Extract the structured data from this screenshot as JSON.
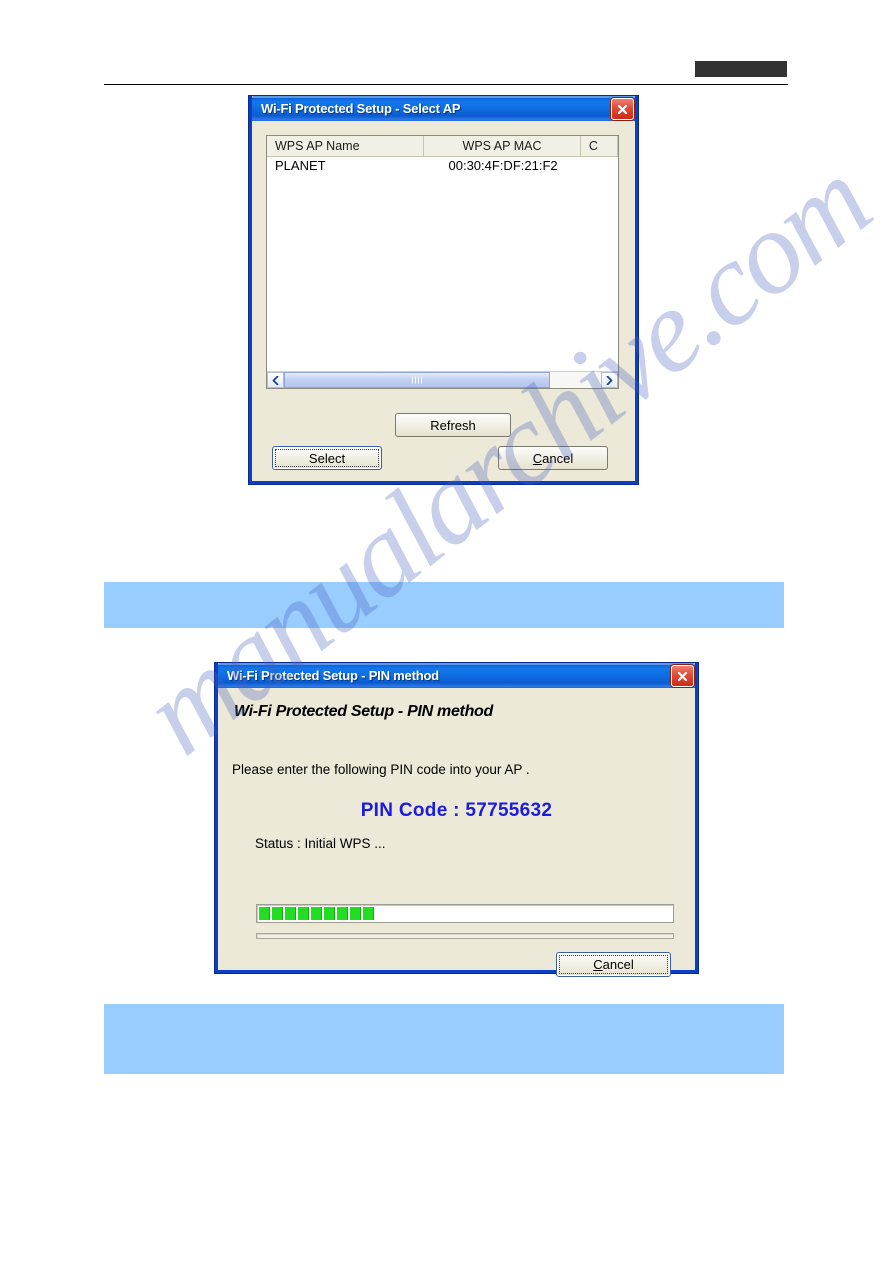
{
  "page": {
    "header_redacted_block": "",
    "watermark_text": "manualarchive.com"
  },
  "bands": {
    "band_1_text": "",
    "band_2_text": ""
  },
  "dialog_select_ap": {
    "title": "Wi-Fi Protected Setup - Select AP",
    "close_icon": "close-icon",
    "list": {
      "columns": [
        "WPS AP Name",
        "WPS AP MAC",
        "C"
      ],
      "rows": [
        {
          "name": "PLANET",
          "mac": "00:30:4F:DF:21:F2",
          "extra": ""
        }
      ]
    },
    "scrollbar": {
      "left_arrow": "◀",
      "right_arrow": "▶"
    },
    "buttons": {
      "refresh": "Refresh",
      "select": "Select",
      "cancel_prefix": "C",
      "cancel_rest": "ancel"
    }
  },
  "dialog_pin_method": {
    "title": "Wi-Fi Protected Setup - PIN method",
    "close_icon": "close-icon",
    "heading": "Wi-Fi Protected Setup - PIN method",
    "instruction": "Please enter the following PIN code into your AP .",
    "pin_label": "PIN Code :",
    "pin_value": "57755632",
    "pin_code_line": "PIN Code :  57755632",
    "status": "Status :  Initial WPS ...",
    "progress_segments": 9,
    "progress_color": "#22dd22",
    "buttons": {
      "cancel_prefix": "C",
      "cancel_rest": "ancel"
    }
  },
  "colors": {
    "titlebar_blue": "#0f6fe2",
    "dialog_face": "#ece9d8",
    "band_blue": "#99ccff",
    "pin_blue": "#1c1cdd",
    "progress_green": "#22dd22",
    "close_red": "#c92d18"
  }
}
